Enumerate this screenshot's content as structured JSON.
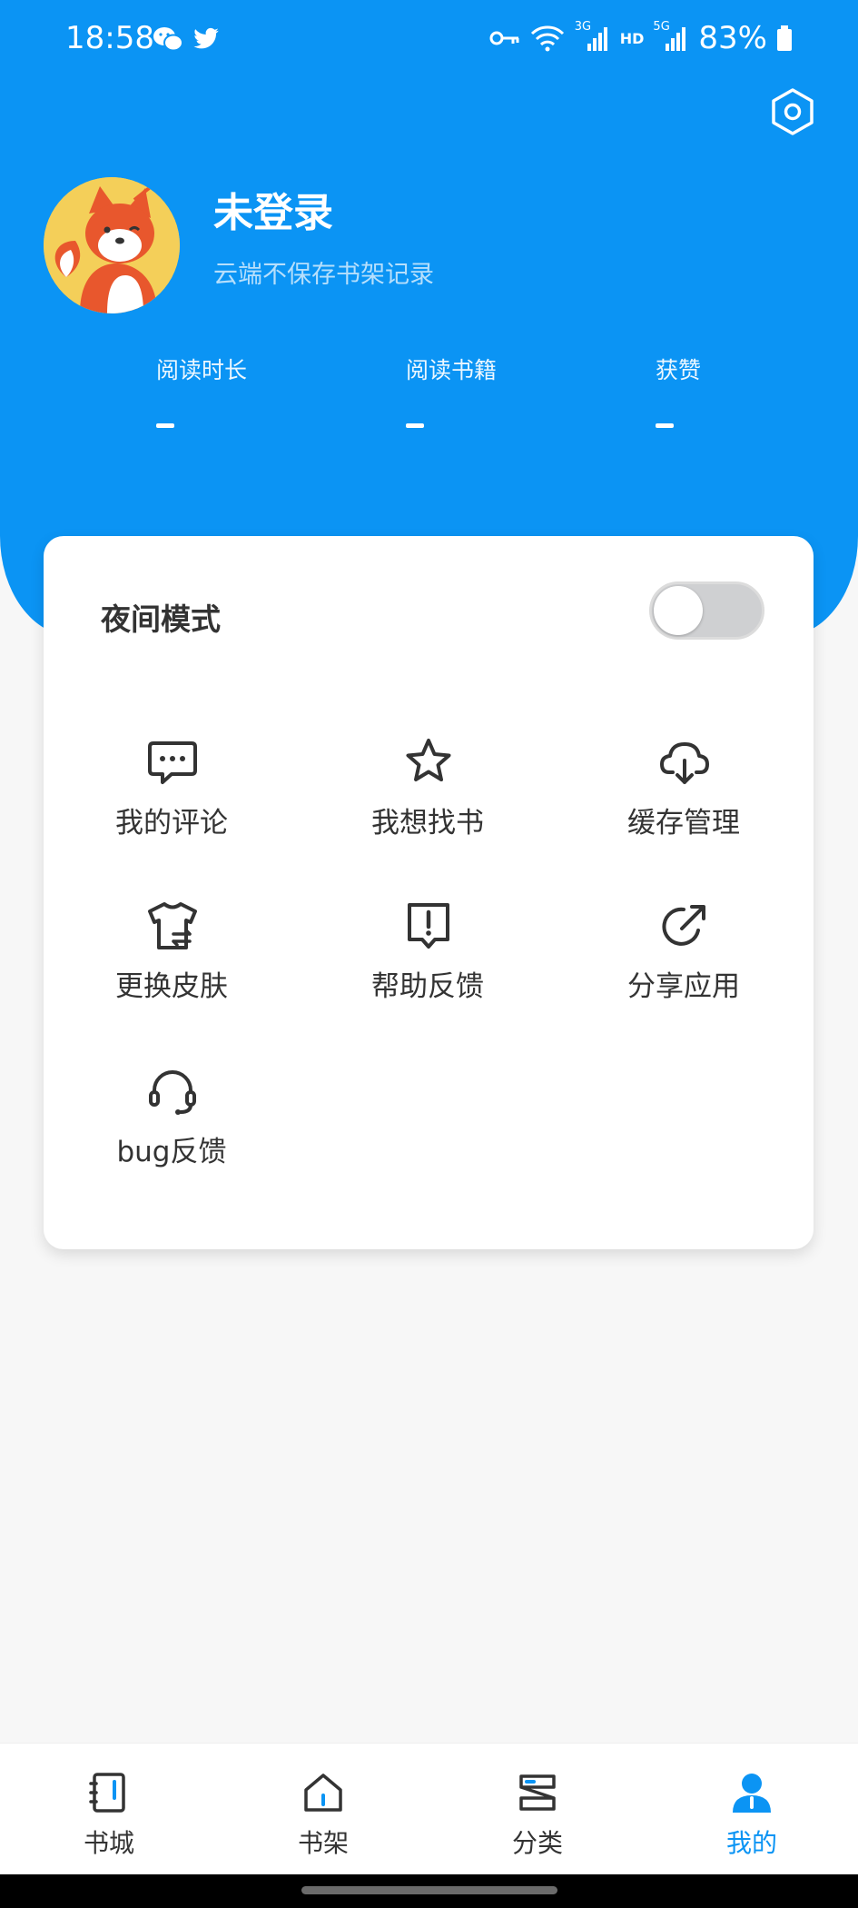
{
  "status_bar": {
    "time": "18:58",
    "battery": "83%",
    "network_3g": "3G",
    "network_hd": "HD",
    "network_5g": "5G"
  },
  "profile": {
    "name": "未登录",
    "subtitle": "云端不保存书架记录"
  },
  "stats": [
    {
      "label": "阅读时长",
      "value": "-"
    },
    {
      "label": "阅读书籍",
      "value": "-"
    },
    {
      "label": "获赞",
      "value": "-"
    }
  ],
  "card": {
    "night_mode_label": "夜间模式",
    "night_mode_on": false,
    "items": [
      {
        "label": "我的评论",
        "icon": "chat-bubble-icon"
      },
      {
        "label": "我想找书",
        "icon": "star-icon"
      },
      {
        "label": "缓存管理",
        "icon": "cloud-download-icon"
      },
      {
        "label": "更换皮肤",
        "icon": "shirt-icon"
      },
      {
        "label": "帮助反馈",
        "icon": "feedback-icon"
      },
      {
        "label": "分享应用",
        "icon": "share-icon"
      },
      {
        "label": "bug反馈",
        "icon": "headset-icon"
      }
    ]
  },
  "nav": {
    "items": [
      {
        "label": "书城",
        "icon": "book-icon"
      },
      {
        "label": "书架",
        "icon": "home-icon"
      },
      {
        "label": "分类",
        "icon": "category-icon"
      },
      {
        "label": "我的",
        "icon": "person-icon",
        "active": true
      }
    ]
  },
  "colors": {
    "accent": "#0b94f4",
    "text": "#333333"
  }
}
